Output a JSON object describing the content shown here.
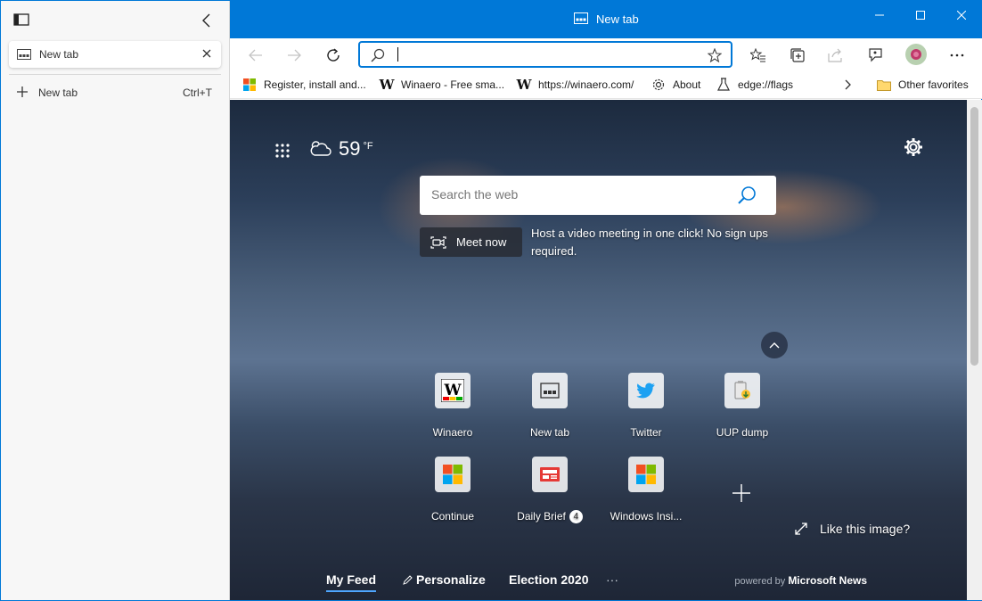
{
  "sidebar": {
    "tab_label": "New tab",
    "new_tab_label": "New tab",
    "new_tab_shortcut": "Ctrl+T"
  },
  "titlebar": {
    "title": "New tab"
  },
  "toolbar": {
    "address_value": ""
  },
  "favorites": [
    {
      "label": "Register, install and...",
      "icon": "microsoft-logo-icon"
    },
    {
      "label": "Winaero - Free sma...",
      "icon": "winaero-icon"
    },
    {
      "label": "https://winaero.com/",
      "icon": "winaero-icon"
    },
    {
      "label": "About",
      "icon": "gear-icon"
    },
    {
      "label": "edge://flags",
      "icon": "flask-icon"
    }
  ],
  "other_favorites": "Other favorites",
  "weather": {
    "temp": "59",
    "unit": "°F"
  },
  "search": {
    "placeholder": "Search the web"
  },
  "meet": {
    "label": "Meet now",
    "promo": "Host a video meeting in one click! No sign ups required."
  },
  "tiles": [
    {
      "name": "Winaero",
      "icon": "winaero-icon"
    },
    {
      "name": "New tab",
      "icon": "new-tab-icon"
    },
    {
      "name": "Twitter",
      "icon": "twitter-icon"
    },
    {
      "name": "UUP dump",
      "icon": "uup-dump-icon"
    },
    {
      "name": "Continue",
      "icon": "microsoft-logo-icon"
    },
    {
      "name": "Daily Brief",
      "icon": "daily-brief-icon",
      "badge": "4"
    },
    {
      "name": "Windows Insi...",
      "icon": "microsoft-logo-icon"
    }
  ],
  "like_image": "Like this image?",
  "feed": {
    "my_feed": "My Feed",
    "personalize": "Personalize",
    "election": "Election 2020",
    "more": "···",
    "powered_prefix": "powered by",
    "powered_brand": "Microsoft News"
  },
  "colors": {
    "accent": "#0078d7",
    "feed_underline": "#4ea6ff"
  }
}
